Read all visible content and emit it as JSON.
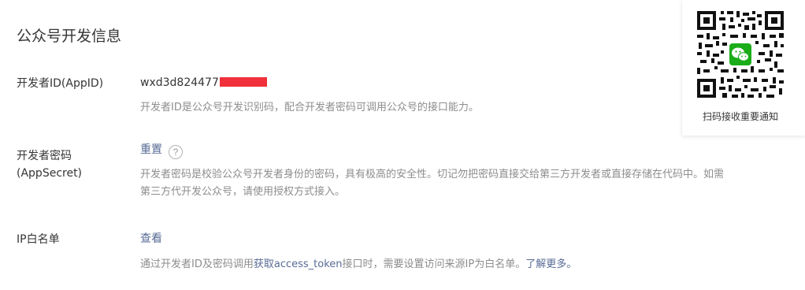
{
  "section": {
    "title": "公众号开发信息"
  },
  "appid": {
    "label": "开发者ID(AppID)",
    "value": "wxd3d824477",
    "description": "开发者ID是公众号开发识别码，配合开发者密码可调用公众号的接口能力。"
  },
  "appsecret": {
    "label_line1": "开发者密码",
    "label_line2": "(AppSecret)",
    "reset_label": "重置",
    "help_icon": "?",
    "description_line1": "开发者密码是校验公众号开发者身份的密码，具有极高的安全性。切记勿把密码直接交给第三方开发者或直接存储在代码中。如需",
    "description_line2": "第三方代开发公众号，请使用授权方式接入。"
  },
  "whitelist": {
    "label": "IP白名单",
    "view_label": "查看",
    "desc_prefix": "通过开发者ID及密码调用",
    "desc_link": "获取access_token",
    "desc_middle": "接口时，需要设置访问来源IP为白名单。",
    "learn_more": "了解更多。"
  },
  "qr_card": {
    "caption": "扫码接收重要通知",
    "icon": "wechat-qr-code"
  },
  "colors": {
    "link": "#576b95",
    "muted_text": "#8d8d8d",
    "redaction": "#f0303a",
    "wechat_green": "#1aad19"
  }
}
